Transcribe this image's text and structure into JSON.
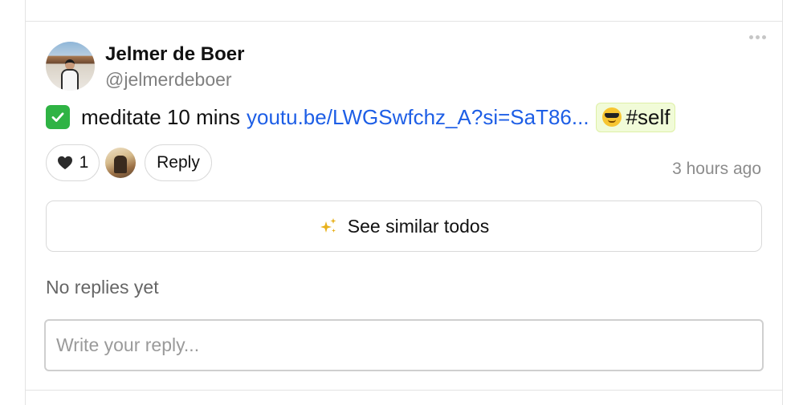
{
  "post": {
    "author_name": "Jelmer de Boer",
    "author_handle": "@jelmerdeboer",
    "more_icon": "more-horizontal-icon",
    "todo": {
      "done": true,
      "checkbox_icon": "checkmark-icon",
      "text": "meditate 10 mins",
      "link_text": "youtu.be/LWGSwfchz_A?si=SaT86...",
      "tag_emoji": "smiling-face-with-sunglasses-icon",
      "tag_label": "#self"
    },
    "likes": {
      "icon": "heart-icon",
      "count": "1"
    },
    "reply_label": "Reply",
    "timestamp": "3 hours ago",
    "similar": {
      "icon": "sparkles-icon",
      "label": "See similar todos"
    },
    "replies_empty_text": "No replies yet",
    "reply_input": {
      "placeholder": "Write your reply...",
      "value": ""
    }
  },
  "colors": {
    "check_green": "#2fb344",
    "link_blue": "#1d5ee6",
    "tag_bg": "#f1fbd8",
    "sparkle_gold": "#e8b11c",
    "muted_text": "#8c8c8c"
  }
}
